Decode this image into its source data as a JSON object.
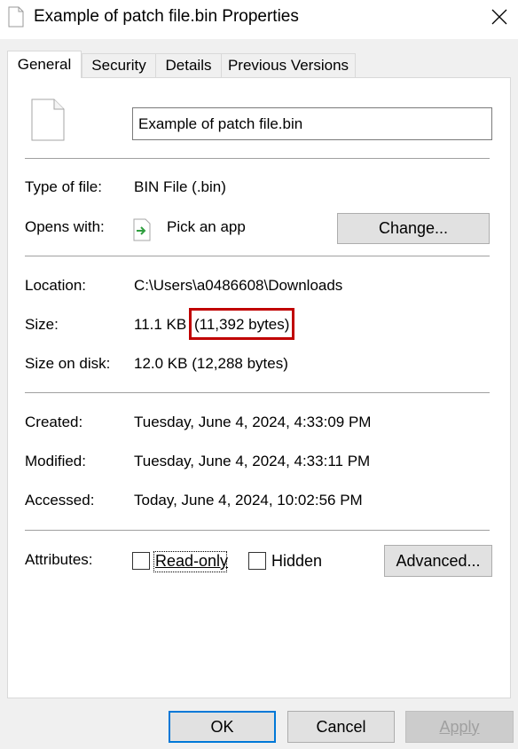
{
  "window": {
    "title": "Example of patch file.bin Properties",
    "close_icon": "close-icon"
  },
  "tabs": [
    {
      "label": "General",
      "active": true
    },
    {
      "label": "Security",
      "active": false
    },
    {
      "label": "Details",
      "active": false
    },
    {
      "label": "Previous Versions",
      "active": false
    }
  ],
  "general": {
    "file_name": "Example of patch file.bin",
    "type_label": "Type of file:",
    "type_value": "BIN File (.bin)",
    "opens_label": "Opens with:",
    "opens_value": "Pick an app",
    "change_button": "Change...",
    "location_label": "Location:",
    "location_value": "C:\\Users\\a0486608\\Downloads",
    "size_label": "Size:",
    "size_value_kb": "11.1 KB",
    "size_value_bytes": "(11,392 bytes)",
    "size_on_disk_label": "Size on disk:",
    "size_on_disk_value": "12.0 KB (12,288 bytes)",
    "created_label": "Created:",
    "created_value": "Tuesday, June 4, 2024, 4:33:09 PM",
    "modified_label": "Modified:",
    "modified_value": "Tuesday, June 4, 2024, 4:33:11 PM",
    "accessed_label": "Accessed:",
    "accessed_value": "Today, June 4, 2024, 10:02:56 PM",
    "attributes_label": "Attributes:",
    "readonly_label": "Read-only",
    "readonly_checked": false,
    "hidden_label": "Hidden",
    "hidden_checked": false,
    "advanced_button": "Advanced..."
  },
  "footer": {
    "ok": "OK",
    "cancel": "Cancel",
    "apply": "Apply"
  },
  "colors": {
    "highlight": "#c00000",
    "default_button_border": "#0078d7",
    "app_arrow": "#2e9e3e"
  }
}
